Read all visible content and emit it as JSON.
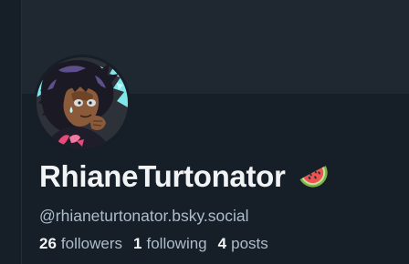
{
  "profile": {
    "display_name": "RhianeTurtonator",
    "name_emoji_icon": "watermelon-icon",
    "handle": "@rhianeturtonator.bsky.social",
    "avatar_icon": "character-avatar-illustration"
  },
  "stats": {
    "followers": {
      "count": "26",
      "label": "followers"
    },
    "following": {
      "count": "1",
      "label": "following"
    },
    "posts": {
      "count": "4",
      "label": "posts"
    }
  },
  "colors": {
    "background": "#161e27",
    "banner": "#1f2731",
    "text_primary": "#f1f3f5",
    "text_secondary": "#aebccb"
  }
}
